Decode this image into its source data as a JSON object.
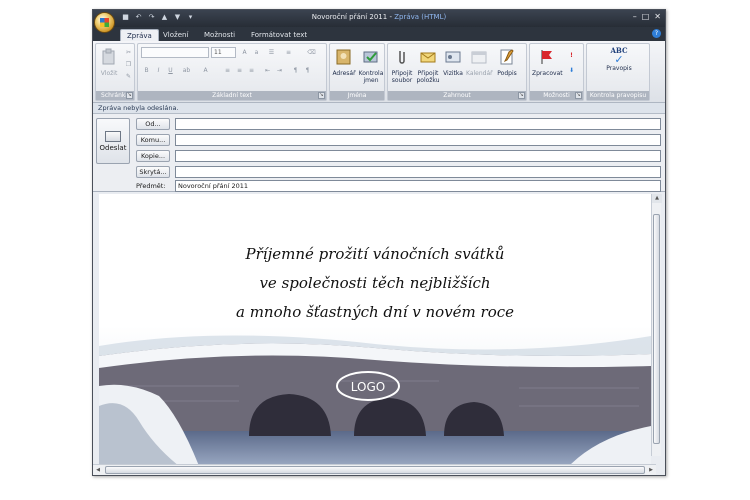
{
  "window": {
    "title": "Novoroční přání 2011",
    "title_separator": " - ",
    "title_format": "Zpráva (HTML)"
  },
  "qat_icons": [
    "save-icon",
    "undo-icon",
    "redo-icon",
    "arrow-up-icon",
    "arrow-down-icon",
    "customize-icon"
  ],
  "tabs": [
    {
      "label": "Zpráva",
      "active": true
    },
    {
      "label": "Vložení",
      "active": false
    },
    {
      "label": "Možnosti",
      "active": false
    },
    {
      "label": "Formátovat text",
      "active": false
    }
  ],
  "ribbon": {
    "groups": {
      "clipboard": "Schránka",
      "basic_text": "Základní text",
      "names": "Jména",
      "include": "Zahrnout",
      "options": "Možnosti",
      "proofing": "Kontrola pravopisu"
    },
    "paste_label": "Vložit",
    "font_size": "11",
    "address_book": "Adresář",
    "check_names": [
      "Kontrola",
      "jmen"
    ],
    "attach_file": [
      "Připojit",
      "soubor"
    ],
    "attach_item": [
      "Připojit",
      "položku"
    ],
    "business_card": "Vizitka",
    "calendar": "Kalendář",
    "signature": "Podpis",
    "follow_up": "Zpracovat",
    "spelling": "Pravopis",
    "spelling_icon_text": "ABC"
  },
  "message_bar": "Zpráva nebyla odeslána.",
  "compose": {
    "send_label": "Odeslat",
    "from_btn": "Od...",
    "to_btn": "Komu...",
    "cc_btn": "Kopie...",
    "bcc_btn": "Skrytá...",
    "subject_label": "Předmět:",
    "from_value": "",
    "to_value": "",
    "cc_value": "",
    "bcc_value": "",
    "subject_value": "Novoroční přání 2011"
  },
  "body": {
    "lines": [
      "Příjemné prožití vánočních svátků",
      "ve společnosti těch nejbližších",
      "a mnoho šťastných dní v novém roce"
    ],
    "logo_text": "LOGO"
  },
  "colors": {
    "title_bar": "#2b313b",
    "ribbon_label": "#aeb5c0",
    "accent": "#2f7ed8",
    "flag": "#d8262b"
  }
}
